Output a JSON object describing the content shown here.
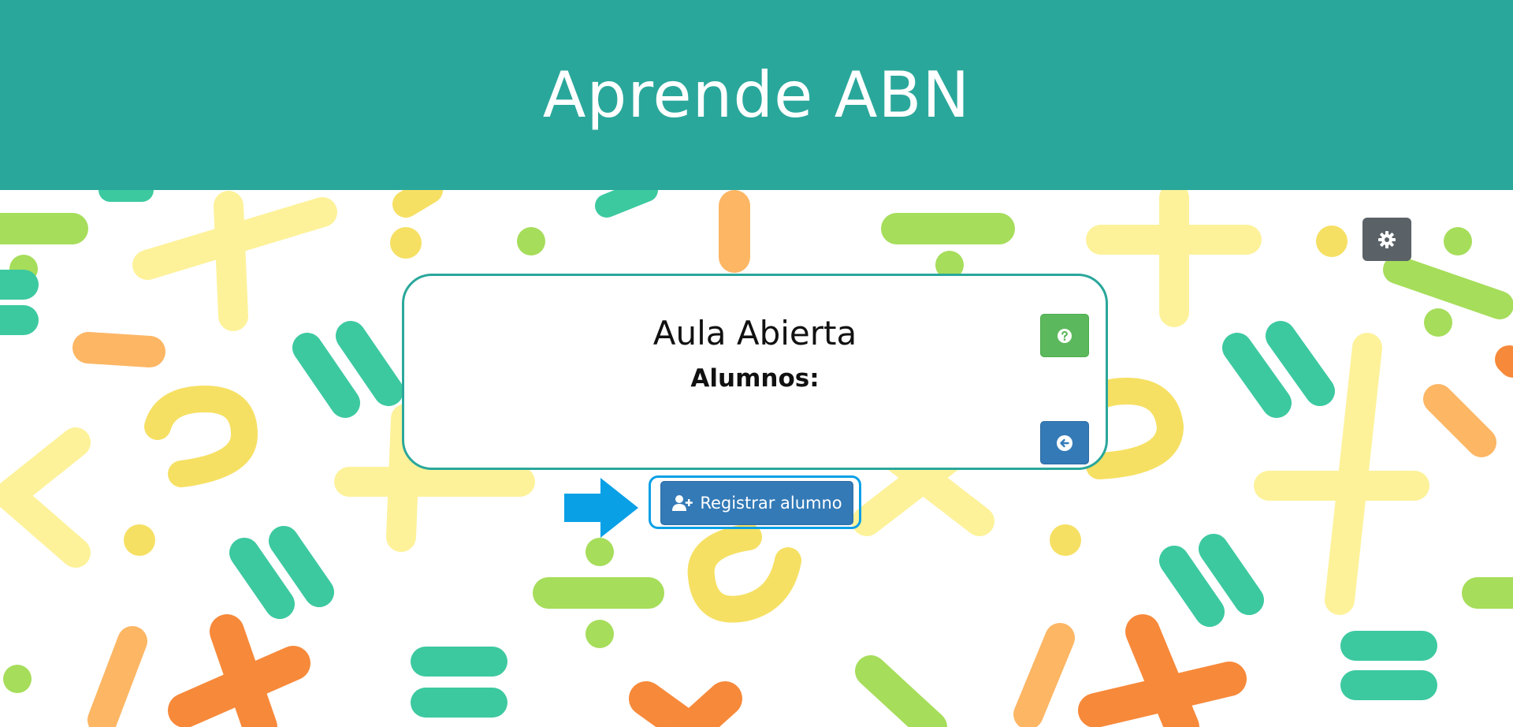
{
  "header": {
    "title": "Aprende ABN"
  },
  "settings": {
    "icon": "gear-icon"
  },
  "card": {
    "title": "Aula Abierta",
    "subtitle": "Alumnos:",
    "help_icon": "question-circle-icon",
    "back_icon": "arrow-left-circle-icon"
  },
  "register": {
    "label": "Registrar alumno",
    "icon": "user-plus-icon"
  },
  "colors": {
    "header_bg": "#2aa79b",
    "card_border": "#2aa79b",
    "primary": "#337ab7",
    "success": "#5cb85c",
    "settings": "#5a6268",
    "highlight": "#0aa0e6"
  }
}
